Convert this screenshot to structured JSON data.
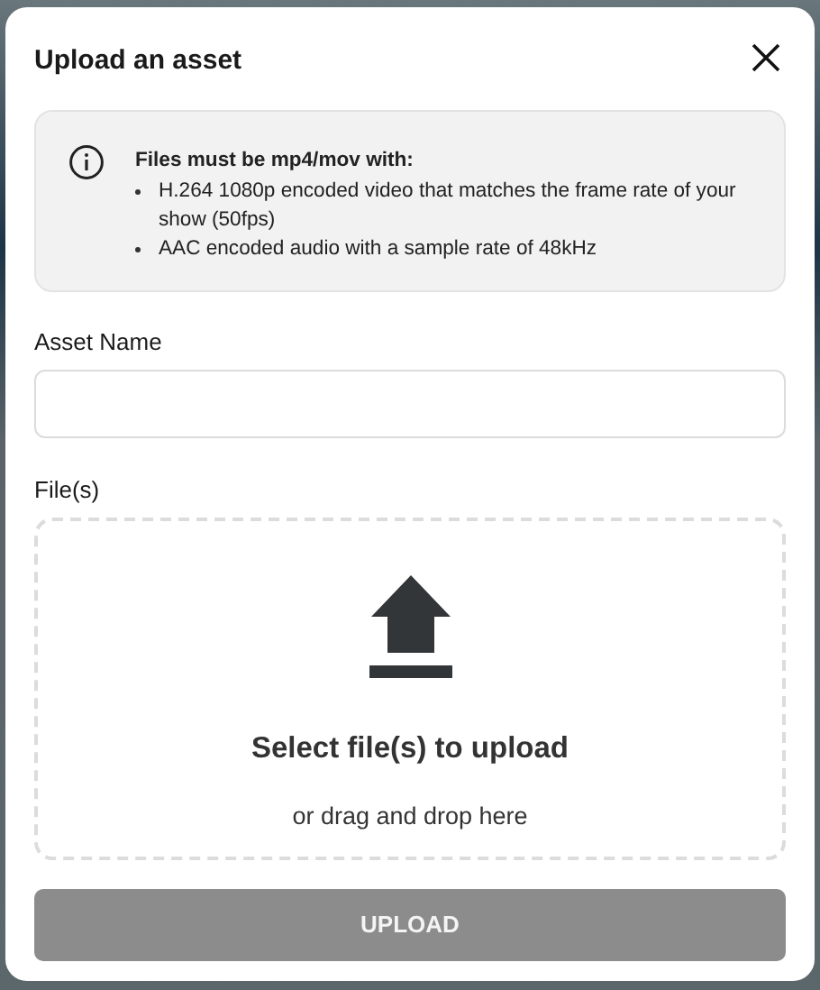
{
  "dialog": {
    "title": "Upload an asset"
  },
  "notice": {
    "heading": "Files must be mp4/mov with:",
    "items": [
      "H.264 1080p encoded video that matches the frame rate of your show (50fps)",
      "AAC encoded audio with a sample rate of 48kHz"
    ]
  },
  "asset_name": {
    "label": "Asset Name"
  },
  "files": {
    "label": "File(s)",
    "prompt": "Select file(s) to upload",
    "hint": "or drag and drop here"
  },
  "upload_button": {
    "label": "UPLOAD",
    "disabled": true
  }
}
